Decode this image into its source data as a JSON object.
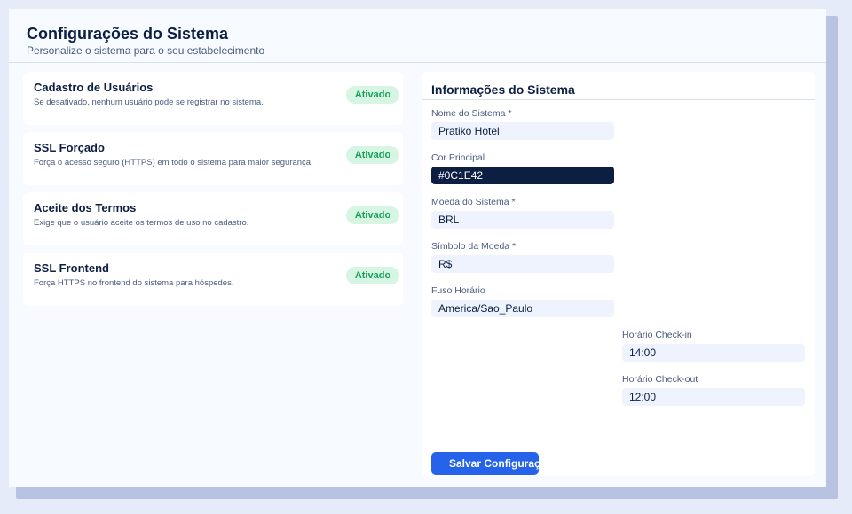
{
  "header": {
    "title": "Configurações do Sistema",
    "subtitle": "Personalize o sistema para o seu estabelecimento"
  },
  "settings": [
    {
      "title": "Cadastro de Usuários",
      "description": "Se desativado, nenhum usuário pode se registrar no sistema.",
      "status": "Ativado"
    },
    {
      "title": "SSL Forçado",
      "description": "Força o acesso seguro (HTTPS) em todo o sistema para maior segurança.",
      "status": "Ativado"
    },
    {
      "title": "Aceite dos Termos",
      "description": "Exige que o usuário aceite os termos de uso no cadastro.",
      "status": "Ativado"
    },
    {
      "title": "SSL Frontend",
      "description": "Força HTTPS no frontend do sistema para hóspedes.",
      "status": "Ativado"
    }
  ],
  "info_panel": {
    "title": "Informações do Sistema",
    "fields": {
      "system_name": {
        "label": "Nome do Sistema *",
        "value": "Pratiko Hotel"
      },
      "primary_color": {
        "label": "Cor Principal",
        "value": "#0C1E42"
      },
      "currency": {
        "label": "Moeda do Sistema *",
        "value": "BRL"
      },
      "currency_symbol": {
        "label": "Símbolo da Moeda *",
        "value": "R$"
      },
      "timezone": {
        "label": "Fuso Horário",
        "value": "America/Sao_Paulo"
      },
      "checkin": {
        "label": "Horário Check-in",
        "value": "14:00"
      },
      "checkout": {
        "label": "Horário Check-out",
        "value": "12:00"
      }
    },
    "save_label": "Salvar Configurações"
  },
  "colors": {
    "primary": "#0C1E42",
    "accent": "#2563EB",
    "badge_bg": "#D6F5E3",
    "badge_text": "#18A058"
  }
}
